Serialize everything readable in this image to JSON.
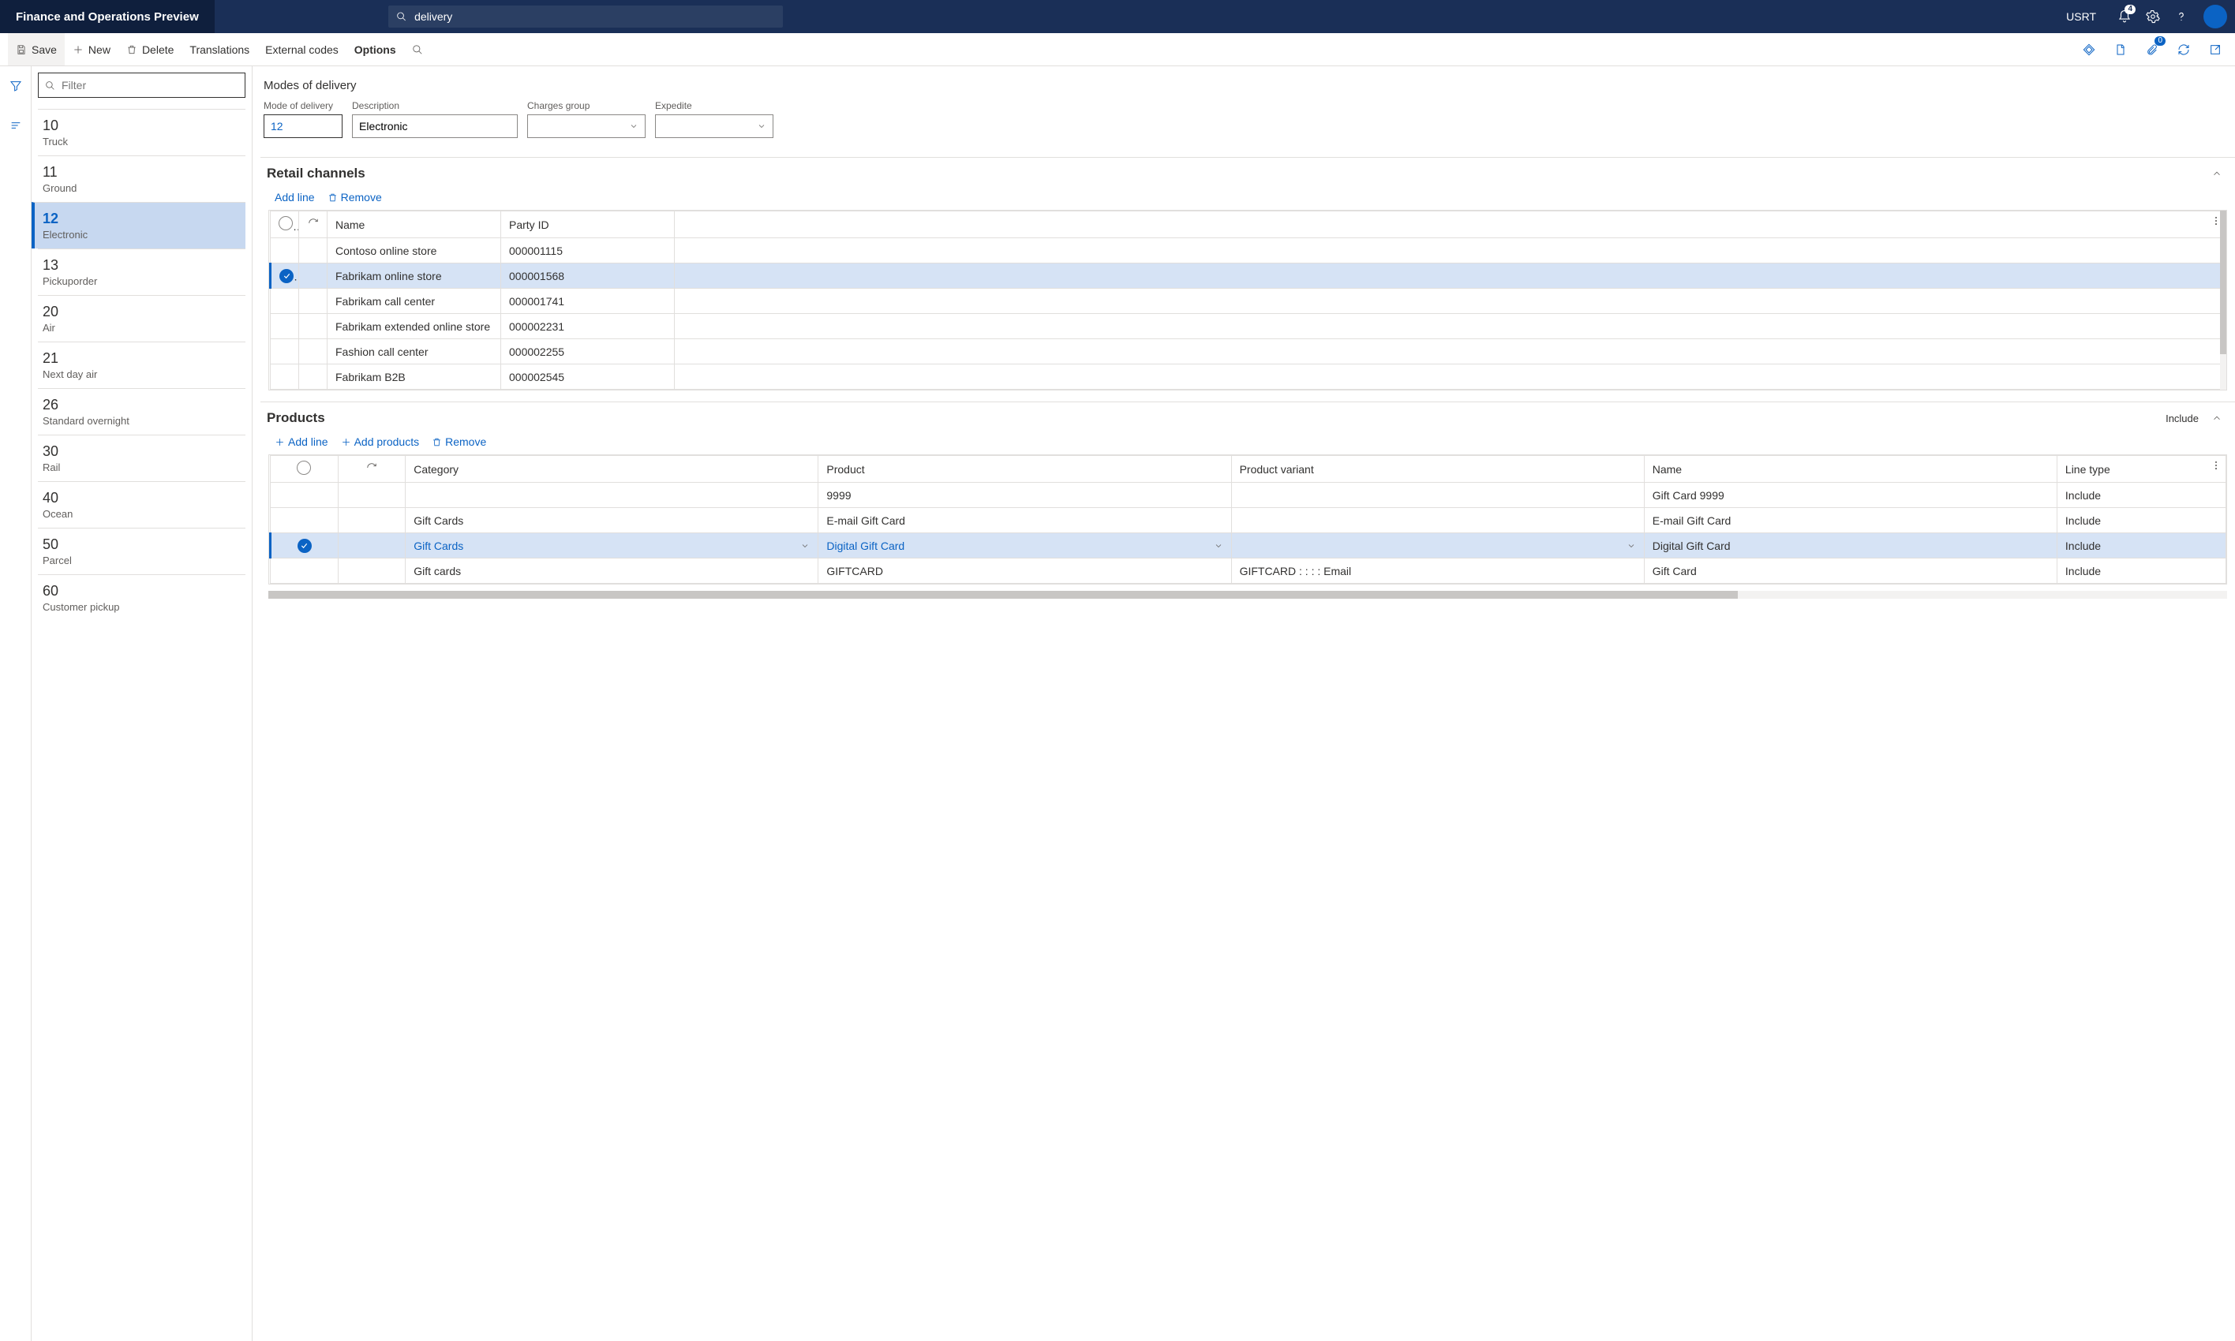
{
  "brand": "Finance and Operations Preview",
  "search": {
    "value": "delivery"
  },
  "company": "USRT",
  "notification_count": "4",
  "attachments_count": "0",
  "cmdbar": {
    "save": "Save",
    "new_": "New",
    "delete_": "Delete",
    "translations": "Translations",
    "external_codes": "External codes",
    "options": "Options"
  },
  "list_filter_placeholder": "Filter",
  "modes": [
    {
      "code": "10",
      "desc": "Truck"
    },
    {
      "code": "11",
      "desc": "Ground"
    },
    {
      "code": "12",
      "desc": "Electronic",
      "selected": true
    },
    {
      "code": "13",
      "desc": "Pickuporder"
    },
    {
      "code": "20",
      "desc": "Air"
    },
    {
      "code": "21",
      "desc": "Next day air"
    },
    {
      "code": "26",
      "desc": "Standard overnight"
    },
    {
      "code": "30",
      "desc": "Rail"
    },
    {
      "code": "40",
      "desc": "Ocean"
    },
    {
      "code": "50",
      "desc": "Parcel"
    },
    {
      "code": "60",
      "desc": "Customer pickup"
    }
  ],
  "page_title": "Modes of delivery",
  "form": {
    "mode_label": "Mode of delivery",
    "mode_value": "12",
    "desc_label": "Description",
    "desc_value": "Electronic",
    "charges_label": "Charges group",
    "charges_value": "",
    "expedite_label": "Expedite",
    "expedite_value": ""
  },
  "retail_section": {
    "title": "Retail channels",
    "add_line": "Add line",
    "remove": "Remove",
    "columns": {
      "name": "Name",
      "party": "Party ID"
    },
    "rows": [
      {
        "name": "Contoso online store",
        "party": "000001115"
      },
      {
        "name": "Fabrikam online store",
        "party": "000001568",
        "selected": true
      },
      {
        "name": "Fabrikam call center",
        "party": "000001741"
      },
      {
        "name": "Fabrikam extended online store",
        "party": "000002231"
      },
      {
        "name": "Fashion call center",
        "party": "000002255"
      },
      {
        "name": "Fabrikam B2B",
        "party": "000002545"
      }
    ]
  },
  "products_section": {
    "title": "Products",
    "include_label": "Include",
    "add_line": "Add line",
    "add_products": "Add products",
    "remove": "Remove",
    "columns": {
      "category": "Category",
      "product": "Product",
      "variant": "Product variant",
      "name": "Name",
      "linetype": "Line type"
    },
    "rows": [
      {
        "category": "",
        "product": "9999",
        "variant": "",
        "name": "Gift Card 9999",
        "linetype": "Include"
      },
      {
        "category": "Gift Cards",
        "product": "E-mail Gift Card",
        "variant": "",
        "name": "E-mail Gift Card",
        "linetype": "Include"
      },
      {
        "category": "Gift Cards",
        "product": "Digital Gift Card",
        "variant": "",
        "name": "Digital Gift Card",
        "linetype": "Include",
        "selected": true
      },
      {
        "category": "Gift cards",
        "product": "GIFTCARD",
        "variant": "GIFTCARD :  :  :  : Email",
        "name": "Gift Card",
        "linetype": "Include"
      }
    ]
  }
}
